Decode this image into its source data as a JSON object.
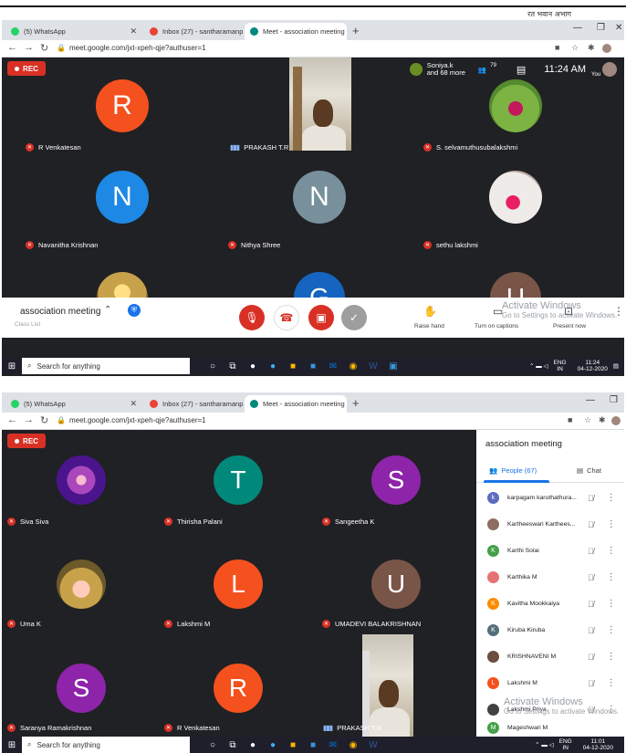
{
  "doc": {
    "header_text": "रत भवान अभाग"
  },
  "browser": {
    "tabs": [
      {
        "label": "(5) WhatsApp",
        "color": "#25d366"
      },
      {
        "label": "Inbox (27) - santharamanpaulraj",
        "color": "#ea4335"
      },
      {
        "label": "Meet - association meeting",
        "color": "#00897b"
      }
    ],
    "url": "meet.google.com/jxt-xpeh-qje?authuser=1"
  },
  "meet": {
    "rec_label": "REC",
    "meeting_name": "association meeting",
    "top_chip_name": "Soniya.k",
    "top_chip_more": "and 68 more",
    "participant_count": "79",
    "time": "11:24 AM",
    "you_label": "You",
    "sub_caption": "Class List",
    "raise_hand": "Raise hand",
    "turn_on_captions": "Turn on captions",
    "present_now": "Present now",
    "activate_title": "Activate Windows",
    "activate_sub": "Go to Settings to activate Windows."
  },
  "grid1": [
    {
      "name": "R Venkatesan",
      "initial": "R",
      "color": "#f4511e"
    },
    {
      "name": "PRAKASH T.R",
      "initial": "",
      "color": ""
    },
    {
      "name": "S. selvamuthusubalakshmi",
      "initial": "",
      "color": "#7cb342"
    },
    {
      "name": "Navanitha Krishnan",
      "initial": "N",
      "color": "#1e88e5"
    },
    {
      "name": "Nithya Shree",
      "initial": "N",
      "color": "#78909c"
    },
    {
      "name": "sethu lakshmi",
      "initial": "",
      "color": "#d7ccc8"
    },
    {
      "name": "",
      "initial": "",
      "color": "#c8a24a"
    },
    {
      "name": "",
      "initial": "G",
      "color": "#1565c0"
    },
    {
      "name": "",
      "initial": "U",
      "color": "#795548"
    }
  ],
  "grid2": [
    {
      "name": "Siva Siva",
      "initial": "",
      "color": "#6a1b9a"
    },
    {
      "name": "Thirisha Palani",
      "initial": "T",
      "color": "#00897b"
    },
    {
      "name": "Sangeetha K",
      "initial": "S",
      "color": "#8e24aa"
    },
    {
      "name": "Uma K",
      "initial": "",
      "color": "#c8a24a"
    },
    {
      "name": "Lakshmi M",
      "initial": "L",
      "color": "#f4511e"
    },
    {
      "name": "UMADEVI BALAKRISHNAN",
      "initial": "U",
      "color": "#795548"
    },
    {
      "name": "Saranya Ramakrishnan",
      "initial": "S",
      "color": "#8e24aa"
    },
    {
      "name": "R Venkatesan",
      "initial": "R",
      "color": "#f4511e"
    },
    {
      "name": "PRAKASH T.R",
      "initial": "",
      "color": ""
    }
  ],
  "panel": {
    "title": "association meeting",
    "people_tab": "People (67)",
    "chat_tab": "Chat",
    "people": [
      {
        "name": "karpagam karuthathura...",
        "initial": "k",
        "color": "#5c6bc0"
      },
      {
        "name": "Kartheeswari Karthees...",
        "initial": "",
        "color": "#8d6e63"
      },
      {
        "name": "Karthi Solai",
        "initial": "K",
        "color": "#43a047"
      },
      {
        "name": "Karthika M",
        "initial": "",
        "color": "#e57373"
      },
      {
        "name": "Kavitha Mookkaiya",
        "initial": "K",
        "color": "#fb8c00"
      },
      {
        "name": "Kiruba Kiruba",
        "initial": "K",
        "color": "#546e7a"
      },
      {
        "name": "KRISHNAVENI M",
        "initial": "",
        "color": "#6d4c41"
      },
      {
        "name": "Lakshmi M",
        "initial": "L",
        "color": "#f4511e"
      },
      {
        "name": "Lakshmi Priya",
        "initial": "",
        "color": "#424242"
      },
      {
        "name": "Mageshwari M",
        "initial": "M",
        "color": "#43a047"
      }
    ]
  },
  "taskbar": {
    "search_placeholder": "Search for anything",
    "lang1": "ENG",
    "lang2": "IN",
    "time1": "11:24",
    "date1": "04-12-2020",
    "time2": "11:01",
    "date2": "04-12-2020"
  }
}
